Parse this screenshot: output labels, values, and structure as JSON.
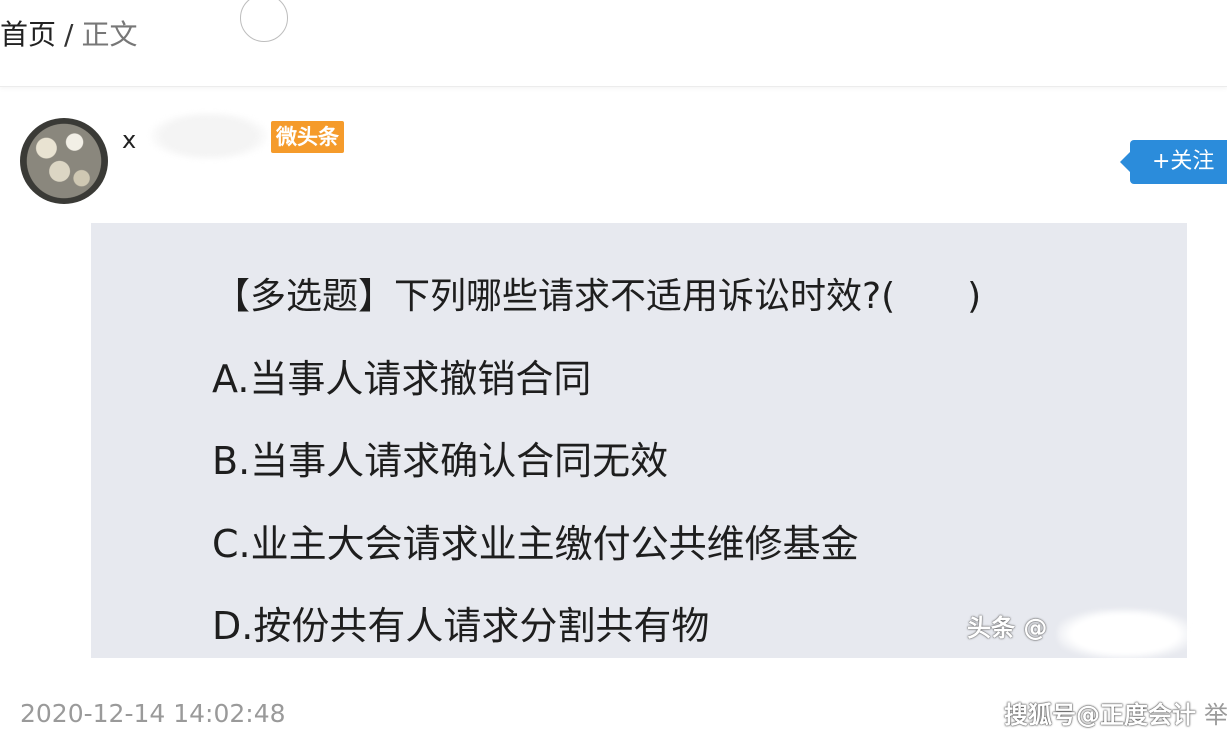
{
  "breadcrumb": {
    "home": "首页",
    "separator": "/",
    "current": "正文"
  },
  "author": {
    "name": "x",
    "badge": "微头条",
    "follow_label": "+关注"
  },
  "quiz": {
    "title": "【多选题】下列哪些请求不适用诉讼时效?(　　)",
    "options": [
      "A.当事人请求撤销合同",
      "B.当事人请求确认合同无效",
      "C.业主大会请求业主缴付公共维修基金",
      "D.按份共有人请求分割共有物"
    ],
    "watermark": "头条 @"
  },
  "footer": {
    "timestamp": "2020-12-14 14:02:48",
    "source": "搜狐号@正度会计",
    "report_label": "举"
  },
  "colors": {
    "badge": "#f59b2b",
    "follow_button": "#2b8cdb",
    "image_background": "#e7e9ef",
    "timestamp": "#9a9a9a"
  }
}
